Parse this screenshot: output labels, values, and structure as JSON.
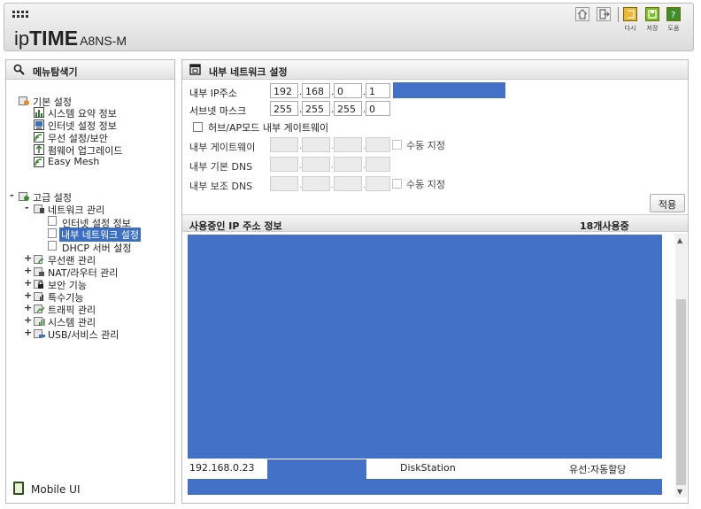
{
  "header": {
    "logo_ip": "ip",
    "logo_time": "TIME",
    "logo_model": "A8NS-M",
    "buttons": [
      {
        "label": "다시",
        "icon": "refresh-icon"
      },
      {
        "label": "저장",
        "icon": "save-icon"
      },
      {
        "label": "도움",
        "icon": "help-icon"
      }
    ]
  },
  "sidebar": {
    "title": "메뉴탐색기",
    "basic": {
      "label": "기본 설정",
      "items": [
        "시스템 요약 정보",
        "인터넷 설정 정보",
        "무선 설정/보안",
        "펌웨어 업그레이드",
        "Easy Mesh"
      ]
    },
    "advanced": {
      "expander": "-",
      "label": "고급 설정",
      "network": {
        "expander": "-",
        "label": "네트워크 관리",
        "items": [
          "인터넷 설정 정보",
          "내부 네트워크 설정",
          "DHCP 서버 설정"
        ]
      },
      "groups": [
        {
          "expander": "+",
          "label": "무선랜 관리"
        },
        {
          "expander": "+",
          "label": "NAT/라우터 관리"
        },
        {
          "expander": "+",
          "label": "보안 기능"
        },
        {
          "expander": "+",
          "label": "특수기능"
        },
        {
          "expander": "+",
          "label": "트래픽 관리"
        },
        {
          "expander": "+",
          "label": "시스템 관리"
        },
        {
          "expander": "+",
          "label": "USB/서비스 관리"
        }
      ]
    },
    "mobile_label": "Mobile UI"
  },
  "main": {
    "title": "내부 네트워크 설정",
    "ip_label": "내부 IP주소",
    "ip": [
      "192",
      "168",
      "0",
      "1"
    ],
    "subnet_label": "서브넷 마스크",
    "subnet": [
      "255",
      "255",
      "255",
      "0"
    ],
    "hub_label": "허브/AP모드 내부 게이트웨이",
    "gateway_label": "내부 게이트웨이",
    "dns1_label": "내부 기본 DNS",
    "dns2_label": "내부 보조 DNS",
    "manual_label_1": "수동 지정",
    "manual_label_2": "수동 지정",
    "apply_label": "적용",
    "list_title": "사용중인 IP 주소 정보",
    "list_count": "18개사용중",
    "row": {
      "ip": "192.168.0.23",
      "name": "DiskStation",
      "type": "유선:자동할당"
    },
    "highlight_color": "#4371c7"
  }
}
